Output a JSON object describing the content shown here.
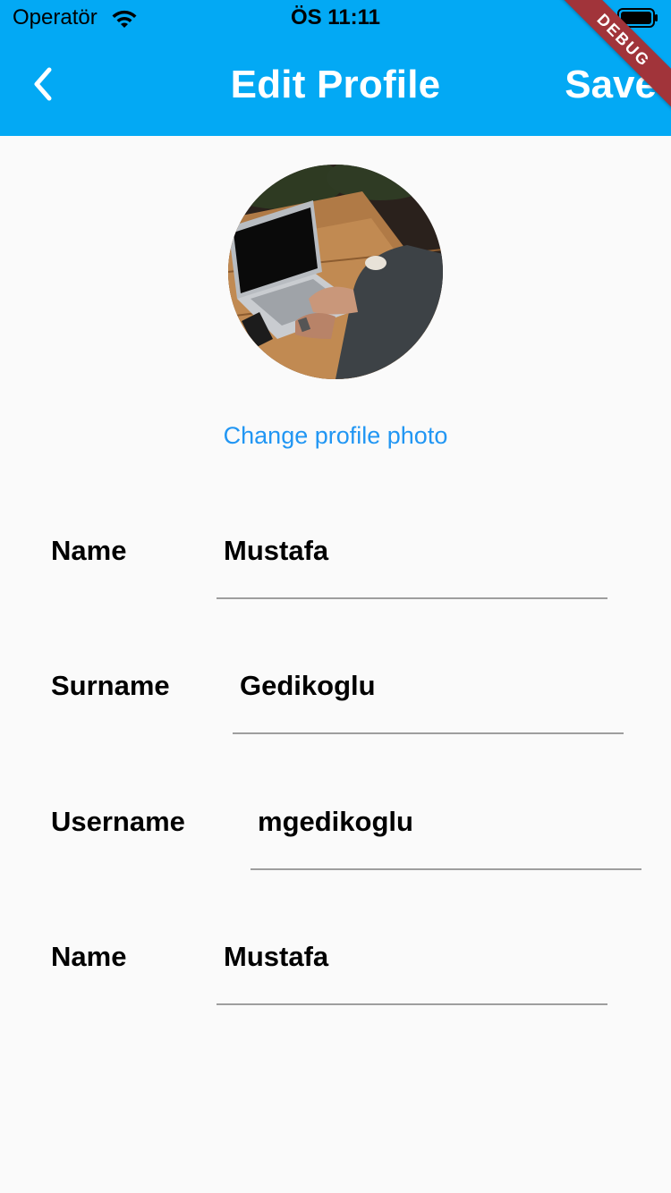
{
  "status_bar": {
    "carrier": "Operatör",
    "time": "ÖS 11:11"
  },
  "header": {
    "back_icon": "chevron-left-icon",
    "title": "Edit Profile",
    "save_label": "Save",
    "background_color": "#03a9f4"
  },
  "debug_banner": {
    "label": "DEBUG",
    "color": "#a1343a"
  },
  "profile": {
    "avatar_alt": "photo-of-person-using-laptop",
    "change_photo_label": "Change profile photo",
    "change_photo_color": "#2196f3"
  },
  "form": {
    "fields": [
      {
        "label": "Name",
        "value": "Mustafa"
      },
      {
        "label": "Surname",
        "value": "Gedikoglu"
      },
      {
        "label": "Username",
        "value": "mgedikoglu"
      },
      {
        "label": "Name",
        "value": "Mustafa"
      }
    ]
  }
}
